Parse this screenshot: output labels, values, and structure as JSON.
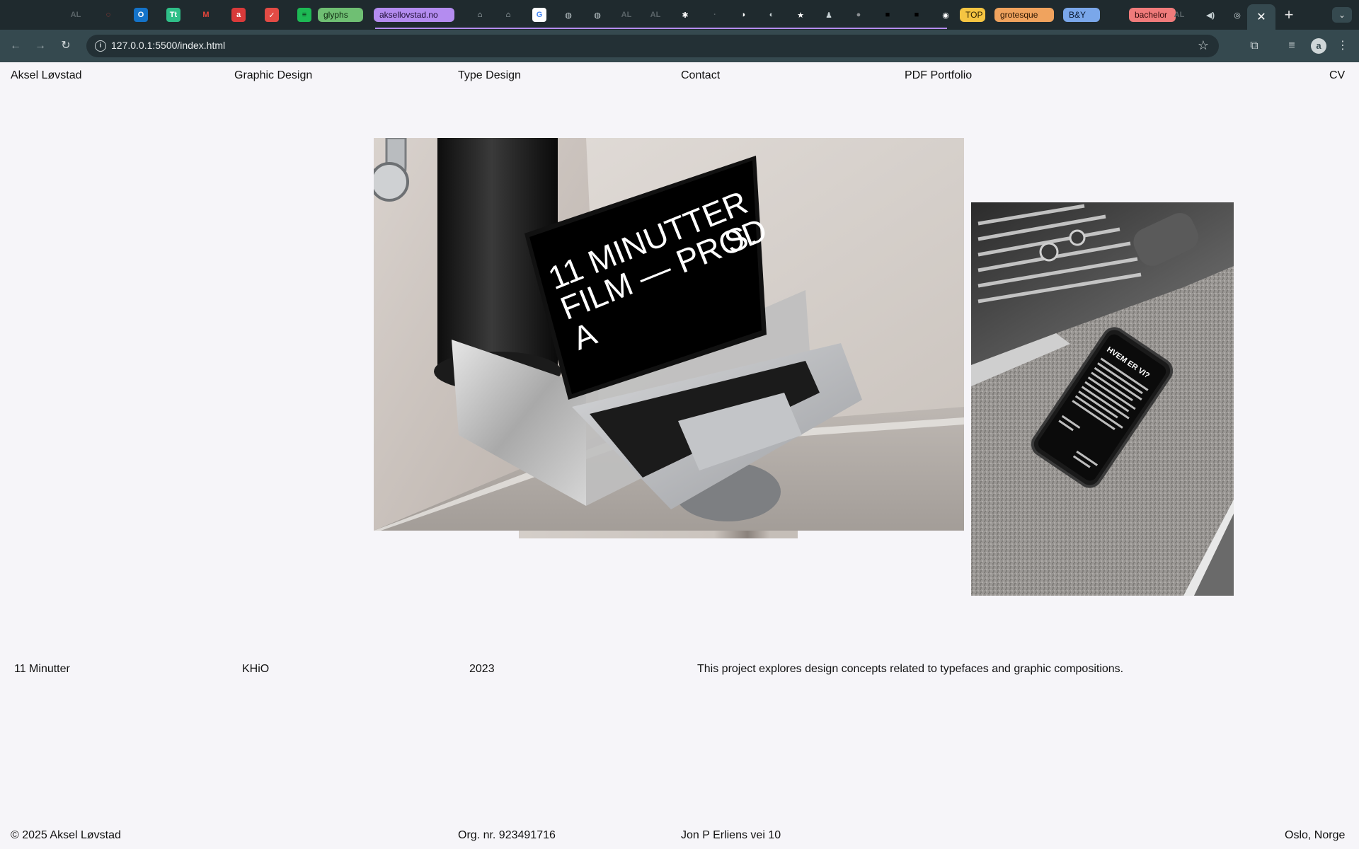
{
  "browser": {
    "tabs": [
      {
        "kind": "icon",
        "glyph": "AL",
        "bg": "transparent",
        "fg": "#5a6468"
      },
      {
        "kind": "icon",
        "glyph": "◌",
        "bg": "transparent",
        "fg": "#e0453a"
      },
      {
        "kind": "icon",
        "glyph": "O",
        "bg": "#1473c9",
        "fg": "#ffffff"
      },
      {
        "kind": "icon",
        "glyph": "Tt",
        "bg": "#2fbf88",
        "fg": "#ffffff"
      },
      {
        "kind": "icon",
        "glyph": "M",
        "bg": "transparent",
        "fg": "#e8463b"
      },
      {
        "kind": "icon",
        "glyph": "a",
        "bg": "#d93a3a",
        "fg": "#ffffff"
      },
      {
        "kind": "icon",
        "glyph": "✓",
        "bg": "#e34b45",
        "fg": "#ffffff"
      },
      {
        "kind": "icon",
        "glyph": "≡",
        "bg": "#1db954",
        "fg": "#0b2a16"
      },
      {
        "kind": "pill",
        "label": "glyphs",
        "bg": "#6fbf73",
        "fg": "#0e2a10"
      },
      {
        "kind": "pill",
        "label": "aksellovstad.no",
        "bg": "#b48cf0",
        "fg": "#1d0d35"
      },
      {
        "kind": "icon",
        "glyph": "⌂",
        "bg": "transparent",
        "fg": "#c9d3d6"
      },
      {
        "kind": "icon",
        "glyph": "⌂",
        "bg": "transparent",
        "fg": "#c9d3d6"
      },
      {
        "kind": "icon",
        "glyph": "G",
        "bg": "#ffffff",
        "fg": "#4285f4"
      },
      {
        "kind": "icon",
        "glyph": "◍",
        "bg": "transparent",
        "fg": "#c9d3d6"
      },
      {
        "kind": "icon",
        "glyph": "◍",
        "bg": "transparent",
        "fg": "#c9d3d6"
      },
      {
        "kind": "icon",
        "glyph": "AL",
        "bg": "transparent",
        "fg": "#5a6468"
      },
      {
        "kind": "icon",
        "glyph": "AL",
        "bg": "transparent",
        "fg": "#5a6468"
      },
      {
        "kind": "icon",
        "glyph": "✱",
        "bg": "transparent",
        "fg": "#ffffff"
      },
      {
        "kind": "icon",
        "glyph": "·",
        "bg": "transparent",
        "fg": "#5a6468"
      },
      {
        "kind": "icon",
        "glyph": "◑",
        "bg": "transparent",
        "fg": "#ffffff"
      },
      {
        "kind": "icon",
        "glyph": "◐",
        "bg": "transparent",
        "fg": "#c9d3d6"
      },
      {
        "kind": "icon",
        "glyph": "★",
        "bg": "transparent",
        "fg": "#ffffff"
      },
      {
        "kind": "icon",
        "glyph": "♟",
        "bg": "transparent",
        "fg": "#c9d3d6"
      },
      {
        "kind": "icon",
        "glyph": "●",
        "bg": "transparent",
        "fg": "#8a8f92"
      },
      {
        "kind": "icon",
        "glyph": "■",
        "bg": "transparent",
        "fg": "#000000"
      },
      {
        "kind": "icon",
        "glyph": "■",
        "bg": "transparent",
        "fg": "#000000"
      },
      {
        "kind": "icon",
        "glyph": "◉",
        "bg": "transparent",
        "fg": "#ffffff"
      },
      {
        "kind": "pill",
        "label": "TOP",
        "bg": "#f5c542",
        "fg": "#2a1e00"
      },
      {
        "kind": "pill",
        "label": "grotesque",
        "bg": "#f0a35e",
        "fg": "#2a1400"
      },
      {
        "kind": "pill",
        "label": "B&Y",
        "bg": "#7aa7ea",
        "fg": "#0a1a33"
      },
      {
        "kind": "pill",
        "label": "bachelor",
        "bg": "#f07b7b",
        "fg": "#330a0a"
      },
      {
        "kind": "icon",
        "glyph": "AL",
        "bg": "transparent",
        "fg": "#5a6468"
      },
      {
        "kind": "icon",
        "glyph": "◀)",
        "bg": "transparent",
        "fg": "#c9d3d6"
      },
      {
        "kind": "icon",
        "glyph": "◎",
        "bg": "transparent",
        "fg": "#c9d3d6"
      }
    ],
    "active_tab_close": "✕",
    "new_tab": "+",
    "tab_menu": "⌄",
    "back": "←",
    "forward": "→",
    "reload": "↻",
    "info_glyph": "i",
    "url": "127.0.0.1:5500/index.html",
    "bookmark_star": "☆",
    "extensions_glyph": "⧉",
    "media_glyph": "≡",
    "avatar_letter": "a",
    "menu_glyph": "⋮"
  },
  "nav": {
    "name": "Aksel Løvstad",
    "graphic_design": "Graphic Design",
    "type_design": "Type Design",
    "contact": "Contact",
    "pdf_portfolio": "PDF Portfolio",
    "cv": "CV"
  },
  "laptop_screen": {
    "line1": "11 MINUTTER",
    "line2": "FILM — PROD",
    "line3": "A",
    "line4": "S."
  },
  "phone_screen": {
    "title": "HVEM ER VI?"
  },
  "project": {
    "title": "11 Minutter",
    "client": "KHiO",
    "year": "2023",
    "description": "This project explores design concepts related to typefaces and graphic compositions."
  },
  "footer": {
    "copyright": "© 2025 Aksel Løvstad",
    "org": "Org. nr. 923491716",
    "address": "Jon P Erliens vei 10",
    "city": "Oslo, Norge"
  }
}
